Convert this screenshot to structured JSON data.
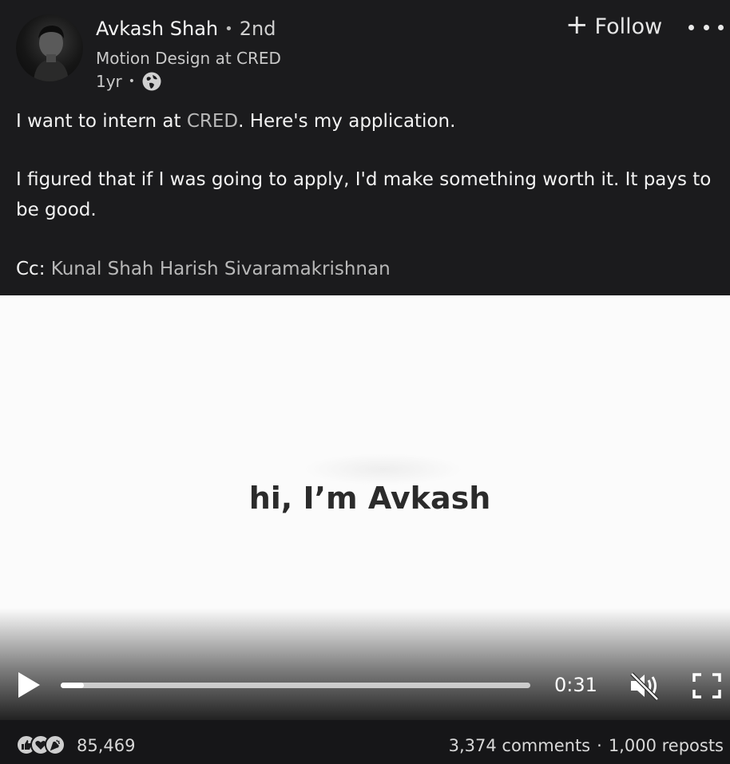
{
  "post": {
    "author_name": "Avkash Shah",
    "separator": "•",
    "connection_degree": "2nd",
    "headline": "Motion Design at CRED",
    "time_ago": "1yr",
    "meta_separator": "•",
    "visibility_icon": "globe-icon",
    "follow_plus": "+",
    "follow_label": "Follow",
    "more_icon": "more-options-icon"
  },
  "body": {
    "p1_before": "I want to intern at ",
    "p1_mention": "CRED",
    "p1_after": ". Here's my application.",
    "p2": "I figured that if I was going to apply, I'd make something worth it. It pays to be good.",
    "cc_prefix": "Cc: ",
    "cc_mention_1": "Kunal Shah",
    "cc_mention_2": "Harish Sivaramakrishnan"
  },
  "video": {
    "caption": "hi, I’m Avkash",
    "time": "0:31",
    "progress": 0.05,
    "play_icon": "play-icon",
    "mute_icon": "mute-icon",
    "fullscreen_icon": "fullscreen-icon"
  },
  "social": {
    "reactions": [
      "like-icon",
      "love-icon",
      "celebrate-icon"
    ],
    "reaction_count": "85,469",
    "comments": "3,374 comments",
    "separator": "·",
    "reposts": "1,000 reposts"
  },
  "colors": {
    "background": "#1b1b1d",
    "video_background": "#fbfbfb",
    "text": "#f2f2f2",
    "mention": "#b8b8b8"
  }
}
